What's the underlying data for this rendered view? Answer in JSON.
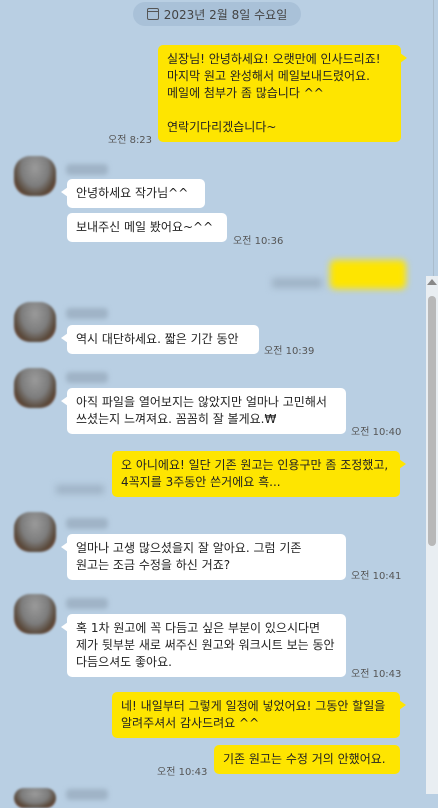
{
  "date_label": "2023년 2월 8일 수요일",
  "messages": [
    {
      "text": "실장님! 안녕하세요! 오랫만에 인사드리죠!\n마지막 원고 완성해서 메일보내드렸어요.\n메일에 첨부가 좀 많습니다 ^^\n\n연락기다리겠습니다~",
      "time": "오전 8:23"
    },
    {
      "text": "안녕하세요 작가님^^",
      "time": ""
    },
    {
      "text": "보내주신 메일 봤어요~^^",
      "time": "오전 10:36"
    },
    {
      "text": "",
      "time": ""
    },
    {
      "text": "역시 대단하세요. 짧은 기간 동안",
      "time": "오전 10:39"
    },
    {
      "text": "아직 파일을 열어보지는 않았지만 얼마나 고민해서 쓰셨는지 느껴져요. 꼼꼼히 잘 볼게요.₩",
      "time": "오전 10:40"
    },
    {
      "text": "오 아니에요! 일단 기존 원고는 인용구만 좀 조정했고, 4꼭지를 3주동안 쓴거에요 흑...",
      "time": ""
    },
    {
      "text": "얼마나 고생 많으셨을지 잘 알아요. 그럼 기존 원고는 조금 수정을 하신 거죠?",
      "time": "오전 10:41"
    },
    {
      "text": "혹 1차 원고에 꼭 다듬고 싶은 부분이 있으시다면\n 제가 뒷부분 새로 써주신 원고와 워크시트 보는 동안 다듬으셔도 좋아요.",
      "time": "오전 10:43"
    },
    {
      "text": "네! 내일부터 그렇게 일정에 넣었어요! 그동안 할일을 알려주셔서 감사드려요 ^^",
      "time": ""
    },
    {
      "text": "기존 원고는 수정 거의 안했어요.",
      "time": "오전 10:43"
    }
  ],
  "colors": {
    "background": "#b9cfe3",
    "my_bubble": "#fee500",
    "other_bubble": "#ffffff"
  }
}
